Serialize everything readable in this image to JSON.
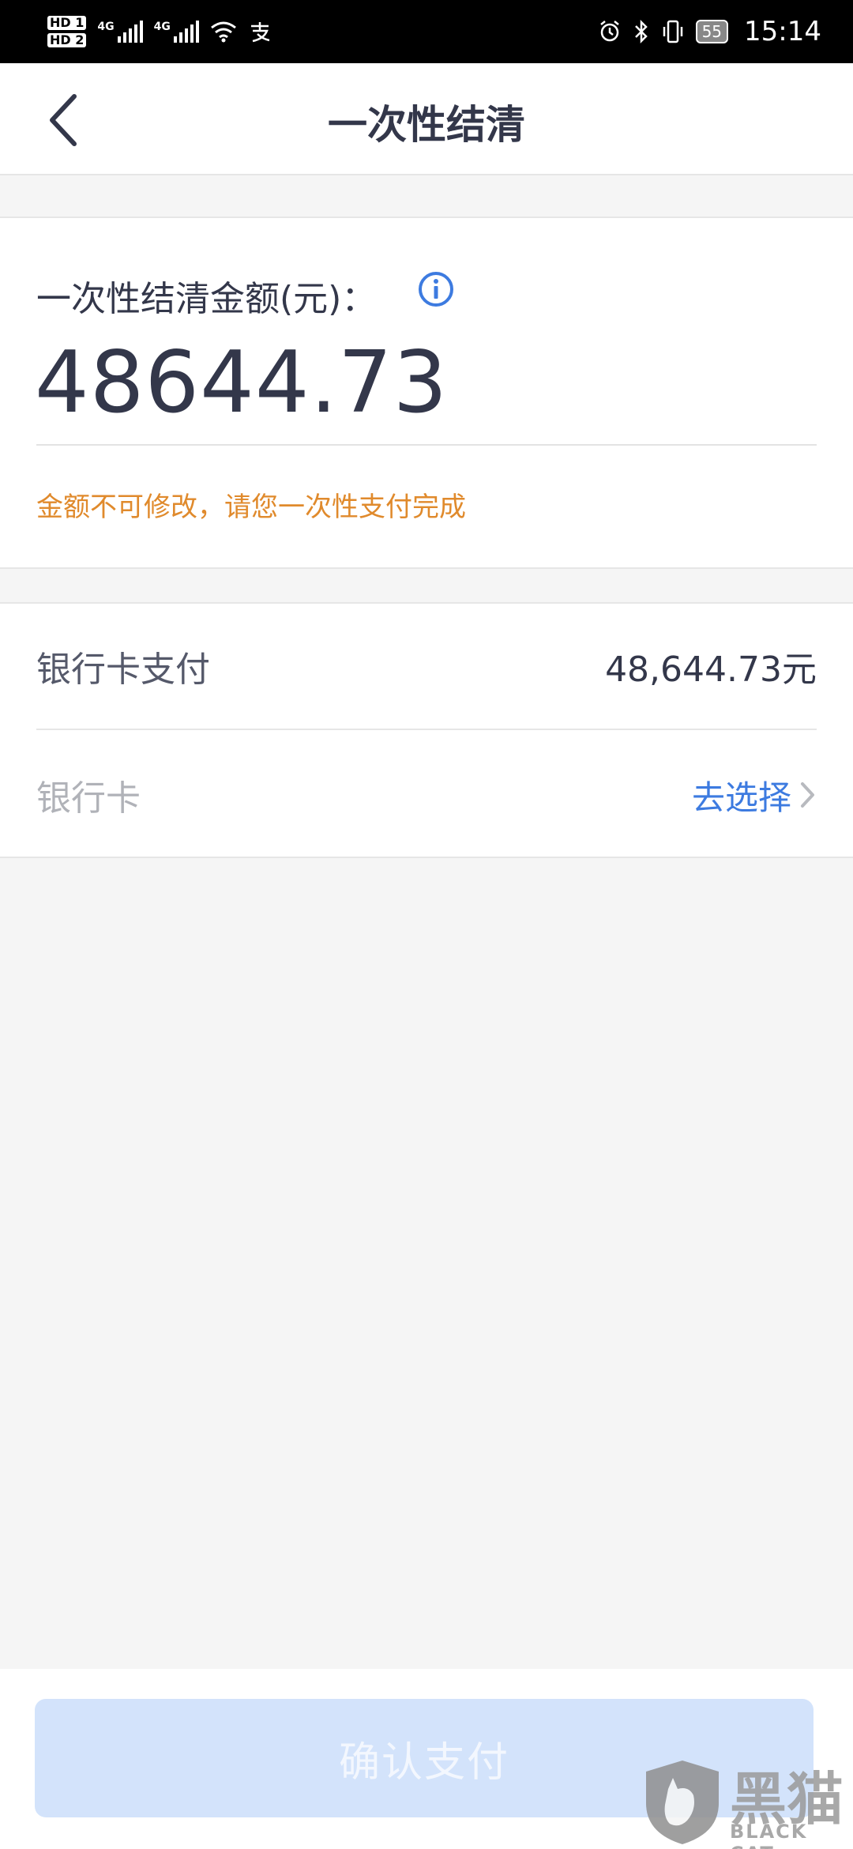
{
  "status_bar": {
    "hd1": "HD 1",
    "hd2": "HD 2",
    "net1": "4G",
    "net2": "4G",
    "time": "15:14",
    "battery": "55"
  },
  "nav": {
    "title": "一次性结清"
  },
  "amount": {
    "label": "一次性结清金额(元)：",
    "value": "48644.73",
    "hint": "金额不可修改，请您一次性支付完成"
  },
  "payment": {
    "method_label": "银行卡支付",
    "method_amount": "48,644.73元",
    "card_label": "银行卡",
    "choose_label": "去选择"
  },
  "confirm": {
    "label": "确认支付"
  },
  "watermark": {
    "cn": "黑猫",
    "en": "BLACK CAT"
  },
  "colors": {
    "accent_blue": "#3d7be0",
    "hint_orange": "#e08a2c",
    "button_disabled": "#d3e3fb",
    "text_dark": "#33374a"
  }
}
